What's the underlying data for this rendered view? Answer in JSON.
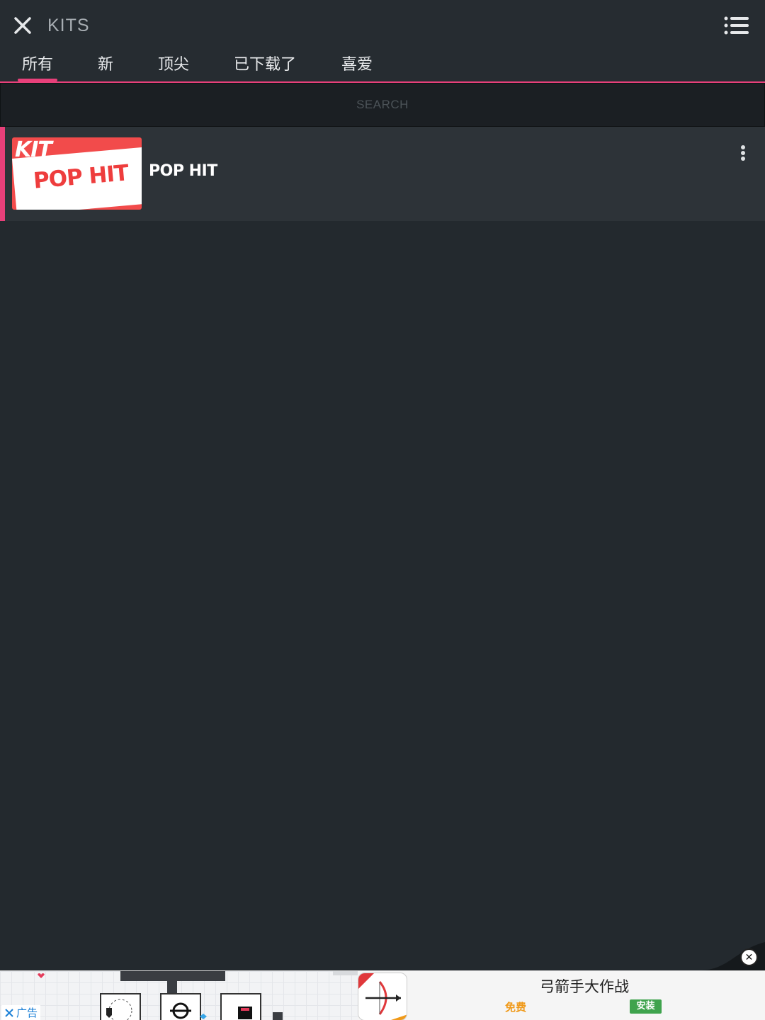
{
  "header": {
    "title": "KITS"
  },
  "tabs": [
    {
      "label": "所有",
      "active": true
    },
    {
      "label": "新"
    },
    {
      "label": "顶尖"
    },
    {
      "label": "已下载了"
    },
    {
      "label": "喜爱"
    }
  ],
  "search": {
    "placeholder": "SEARCH"
  },
  "kits": [
    {
      "name": "POP HIT",
      "thumb_top": "KIT",
      "thumb_main": "POP HIT"
    }
  ],
  "ad": {
    "badge": "广告",
    "title": "弓箭手大作战",
    "price": "免费",
    "install": "安装"
  },
  "colors": {
    "accent": "#e8407a",
    "background": "#23292e",
    "thumb_red": "#f24b4b",
    "install_green": "#3fa34d"
  }
}
